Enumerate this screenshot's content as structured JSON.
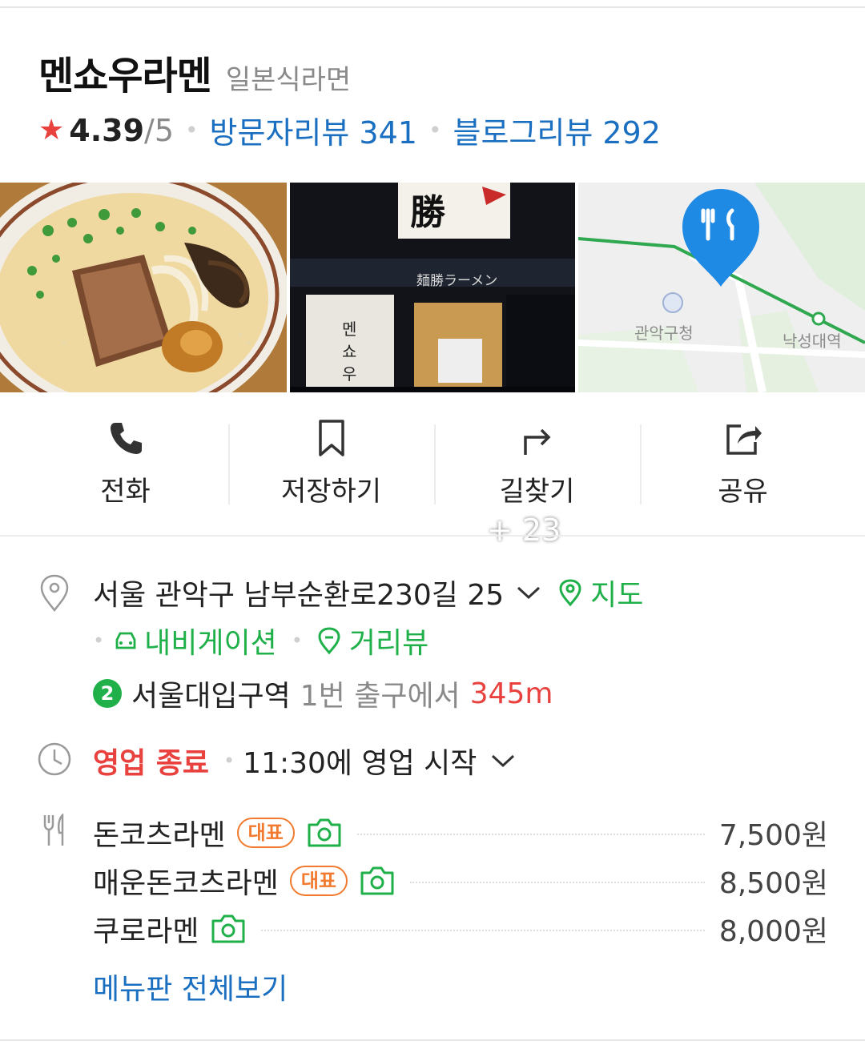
{
  "place": {
    "name": "멘쇼우라멘",
    "category": "일본식라면",
    "rating": "4.39",
    "rating_max": "/5",
    "visitor_review": "방문자리뷰 341",
    "blog_review": "블로그리뷰 292"
  },
  "photos": {
    "more_count": "+ 23",
    "sign_text": "勝",
    "storefront_banner": "麺勝ラーメン",
    "store_sign": [
      "멘",
      "쇼",
      "우"
    ]
  },
  "map_thumb": {
    "label_station1": "관악구청",
    "label_station2": "낙성대역"
  },
  "actions": [
    {
      "label": "전화",
      "icon": "phone-icon"
    },
    {
      "label": "저장하기",
      "icon": "bookmark-icon"
    },
    {
      "label": "길찾기",
      "icon": "directions-icon"
    },
    {
      "label": "공유",
      "icon": "share-icon"
    }
  ],
  "address": {
    "text": "서울 관악구 남부순환로230길 25",
    "map_link": "지도",
    "navigation_link": "내비게이션",
    "street_view_link": "거리뷰"
  },
  "subway": {
    "line": "2",
    "line_color": "#1fb04a",
    "station": "서울대입구역",
    "exit": "1번 출구에서",
    "distance": "345m"
  },
  "hours": {
    "status": "영업 종료",
    "next": "11:30에 영업 시작"
  },
  "menu": {
    "items": [
      {
        "name": "돈코츠라멘",
        "badge": "대표",
        "price": "7,500원"
      },
      {
        "name": "매운돈코츠라멘",
        "badge": "대표",
        "price": "8,500원"
      },
      {
        "name": "쿠로라멘",
        "badge": "",
        "price": "8,000원"
      }
    ],
    "view_all": "메뉴판 전체보기"
  },
  "colors": {
    "link_blue": "#1a6fc1",
    "green": "#1fb04a",
    "red": "#e8413e",
    "badge_orange": "#f27a2e"
  }
}
